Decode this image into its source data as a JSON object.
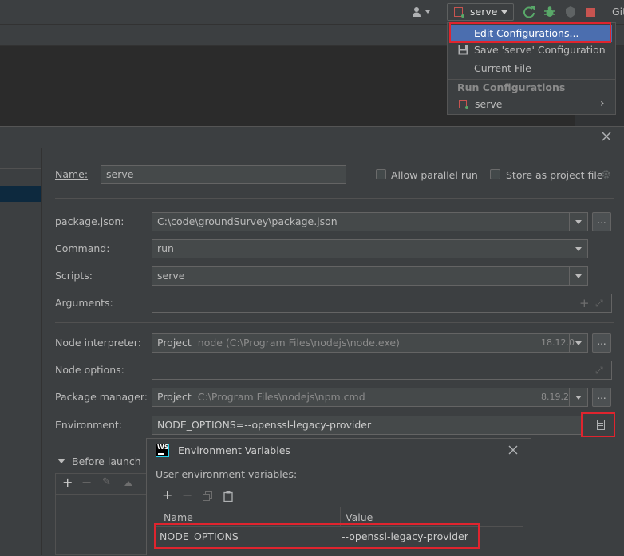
{
  "toolbar": {
    "run_config": "serve",
    "git_label": "Git"
  },
  "run_menu": {
    "edit_configurations": "Edit Configurations...",
    "save_serve": "Save 'serve' Configuration",
    "current_file": "Current File",
    "section_header": "Run Configurations",
    "serve_item": "serve"
  },
  "dialog": {
    "name_label": "Name:",
    "name_value": "serve",
    "allow_parallel_label": "Allow parallel run",
    "store_project_label": "Store as project file",
    "package_json_label": "package.json:",
    "package_json_value": "C:\\code\\groundSurvey\\package.json",
    "command_label": "Command:",
    "command_value": "run",
    "scripts_label": "Scripts:",
    "scripts_value": "serve",
    "arguments_label": "Arguments:",
    "node_interpreter_label": "Node interpreter:",
    "node_interpreter_prefix": "Project",
    "node_interpreter_path": "node (C:\\Program Files\\nodejs\\node.exe)",
    "node_version": "18.12.0",
    "node_options_label": "Node options:",
    "package_manager_label": "Package manager:",
    "package_manager_prefix": "Project",
    "package_manager_path": "C:\\Program Files\\nodejs\\npm.cmd",
    "npm_version": "8.19.2",
    "environment_label": "Environment:",
    "environment_value": "NODE_OPTIONS=--openssl-legacy-provider",
    "before_launch_label": "Before launch",
    "dots": "..."
  },
  "env_dialog": {
    "logo": "WS",
    "title": "Environment Variables",
    "user_vars_label": "User environment variables:",
    "col_name": "Name",
    "col_value": "Value",
    "row_name": "NODE_OPTIONS",
    "row_value": "--openssl-legacy-provider"
  },
  "colors": {
    "accent": "#4b6eaf",
    "highlight_red": "#e0242e",
    "run_green": "#59a869",
    "stop_red": "#c75450"
  }
}
